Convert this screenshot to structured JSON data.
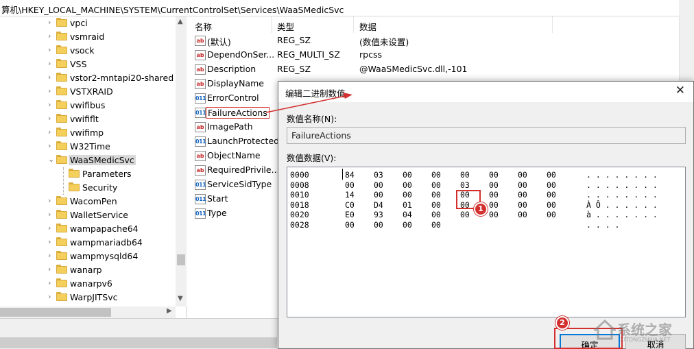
{
  "address_bar": "算机\\HKEY_LOCAL_MACHINE\\SYSTEM\\CurrentControlSet\\Services\\WaaSMedicSvc",
  "tree": {
    "items": [
      {
        "label": "vpci",
        "expandable": true
      },
      {
        "label": "vsmraid",
        "expandable": true
      },
      {
        "label": "vsock",
        "expandable": true
      },
      {
        "label": "VSS",
        "expandable": true
      },
      {
        "label": "vstor2-mntapi20-shared",
        "expandable": true
      },
      {
        "label": "VSTXRAID",
        "expandable": true
      },
      {
        "label": "vwifibus",
        "expandable": true
      },
      {
        "label": "vwififlt",
        "expandable": true
      },
      {
        "label": "vwifimp",
        "expandable": true
      },
      {
        "label": "W32Time",
        "expandable": true
      },
      {
        "label": "WaaSMedicSvc",
        "expandable": true,
        "expanded": true,
        "selected": true
      },
      {
        "label": "Parameters",
        "expandable": false,
        "child": true
      },
      {
        "label": "Security",
        "expandable": false,
        "child": true
      },
      {
        "label": "WacomPen",
        "expandable": true
      },
      {
        "label": "WalletService",
        "expandable": true
      },
      {
        "label": "wampapache64",
        "expandable": true
      },
      {
        "label": "wampmariadb64",
        "expandable": true
      },
      {
        "label": "wampmysqld64",
        "expandable": true
      },
      {
        "label": "wanarp",
        "expandable": true
      },
      {
        "label": "wanarpv6",
        "expandable": true
      },
      {
        "label": "WarpJITSvc",
        "expandable": true
      }
    ]
  },
  "values_pane": {
    "headers": {
      "name": "名称",
      "type": "类型",
      "data": "数据"
    },
    "rows": [
      {
        "icon": "string",
        "name": "(默认)",
        "type": "REG_SZ",
        "data": "(数值未设置)"
      },
      {
        "icon": "string",
        "name": "DependOnSer...",
        "type": "REG_MULTI_SZ",
        "data": "rpcss"
      },
      {
        "icon": "string",
        "name": "Description",
        "type": "REG_SZ",
        "data": "@WaaSMedicSvc.dll,-101"
      },
      {
        "icon": "string",
        "name": "DisplayName",
        "type": "",
        "data": ""
      },
      {
        "icon": "binary",
        "name": "ErrorControl",
        "type": "",
        "data": ""
      },
      {
        "icon": "binary",
        "name": "FailureActions",
        "type": "",
        "data": "",
        "highlighted": true
      },
      {
        "icon": "string",
        "name": "ImagePath",
        "type": "",
        "data": ""
      },
      {
        "icon": "binary",
        "name": "LaunchProtected",
        "type": "",
        "data": ""
      },
      {
        "icon": "string",
        "name": "ObjectName",
        "type": "",
        "data": ""
      },
      {
        "icon": "string",
        "name": "RequiredPrivile...",
        "type": "",
        "data": ""
      },
      {
        "icon": "binary",
        "name": "ServiceSidType",
        "type": "",
        "data": ""
      },
      {
        "icon": "binary",
        "name": "Start",
        "type": "",
        "data": ""
      },
      {
        "icon": "binary",
        "name": "Type",
        "type": "",
        "data": ""
      }
    ]
  },
  "dialog": {
    "title": "编辑二进制数值",
    "close_glyph": "✕",
    "value_name_label": "数值名称(N):",
    "value_name": "FailureActions",
    "value_data_label": "数值数据(V):",
    "hex_rows": [
      {
        "offset": "0000",
        "bytes": [
          "84",
          "03",
          "00",
          "00",
          "00",
          "00",
          "00",
          "00"
        ],
        "ascii": ". . . . . . . ."
      },
      {
        "offset": "0008",
        "bytes": [
          "00",
          "00",
          "00",
          "00",
          "03",
          "00",
          "00",
          "00"
        ],
        "ascii": ". . . . . . . ."
      },
      {
        "offset": "0010",
        "bytes": [
          "14",
          "00",
          "00",
          "00",
          "00",
          "00",
          "00",
          "00"
        ],
        "ascii": ". . . . . . . ."
      },
      {
        "offset": "0018",
        "bytes": [
          "C0",
          "D4",
          "01",
          "00",
          "00",
          "00",
          "00",
          "00"
        ],
        "ascii": "À Ô . . . . . ."
      },
      {
        "offset": "0020",
        "bytes": [
          "E0",
          "93",
          "04",
          "00",
          "00",
          "00",
          "00",
          "00"
        ],
        "ascii": "à . . . . . . ."
      },
      {
        "offset": "0028",
        "bytes": [
          "00",
          "00",
          "00",
          "00",
          "",
          "",
          "",
          ""
        ],
        "ascii": ". . . ."
      }
    ],
    "ok_label": "确定",
    "cancel_label": "取消"
  },
  "annotations": {
    "badge1": "1",
    "badge2": "2"
  },
  "watermark": {
    "text": "系统之家",
    "url": "XITONGZHIJIA.NET"
  },
  "colors": {
    "annotation_red": "#d32f2f",
    "selection_gray": "#d9d9d9",
    "dialog_bg": "#f0f0f0",
    "default_button_blue": "#0078d7"
  }
}
